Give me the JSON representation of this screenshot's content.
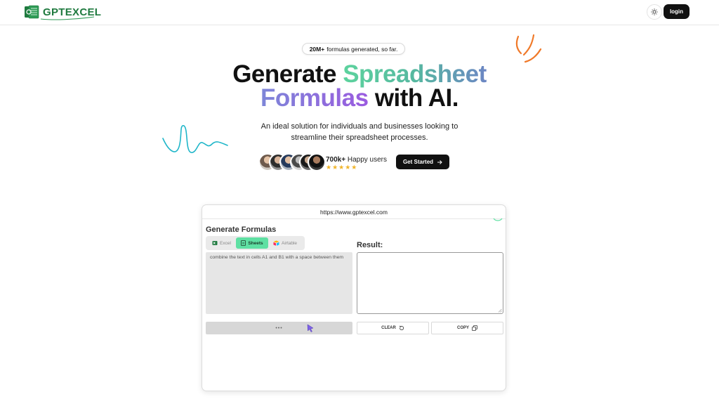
{
  "header": {
    "logo_text": "GPTEXCEL",
    "login_label": "login"
  },
  "hero": {
    "pill_bold": "20M+",
    "pill_text": "formulas generated, so far.",
    "headline_line1_plain": "Generate",
    "headline_line1_gradient": "Spreadsheet",
    "headline_line2_gradient": "Formulas",
    "headline_line2_plain": "with AI.",
    "subtitle_line1": "An ideal solution for individuals and businesses looking to",
    "subtitle_line2": "streamline their spreadsheet processes.",
    "users_count": "700k+",
    "users_label": "Happy users",
    "stars": "★★★★★",
    "cta_label": "Get Started",
    "cta_icon": "arrow-right-icon"
  },
  "demo": {
    "url": "https://www.gptexcel.com",
    "title": "Generate Formulas",
    "tabs": [
      {
        "label": "Excel",
        "selected": false
      },
      {
        "label": "Sheets",
        "selected": true
      },
      {
        "label": "Airtable",
        "selected": false
      }
    ],
    "prompt_value": "combine the text in cells A1 and B1 with a space between them",
    "result_label": "Result:",
    "result_value": "",
    "generate_label": "•••",
    "clear_label": "CLEAR",
    "copy_label": "COPY"
  },
  "colors": {
    "brand_green": "#1f7a3f",
    "sheets_tab": "#5fe0a3",
    "gradient_green": "#5dd39e",
    "gradient_purple": "#9b5be0",
    "squiggle_blue": "#1fb6c9",
    "squiggle_orange": "#f07a2a"
  }
}
